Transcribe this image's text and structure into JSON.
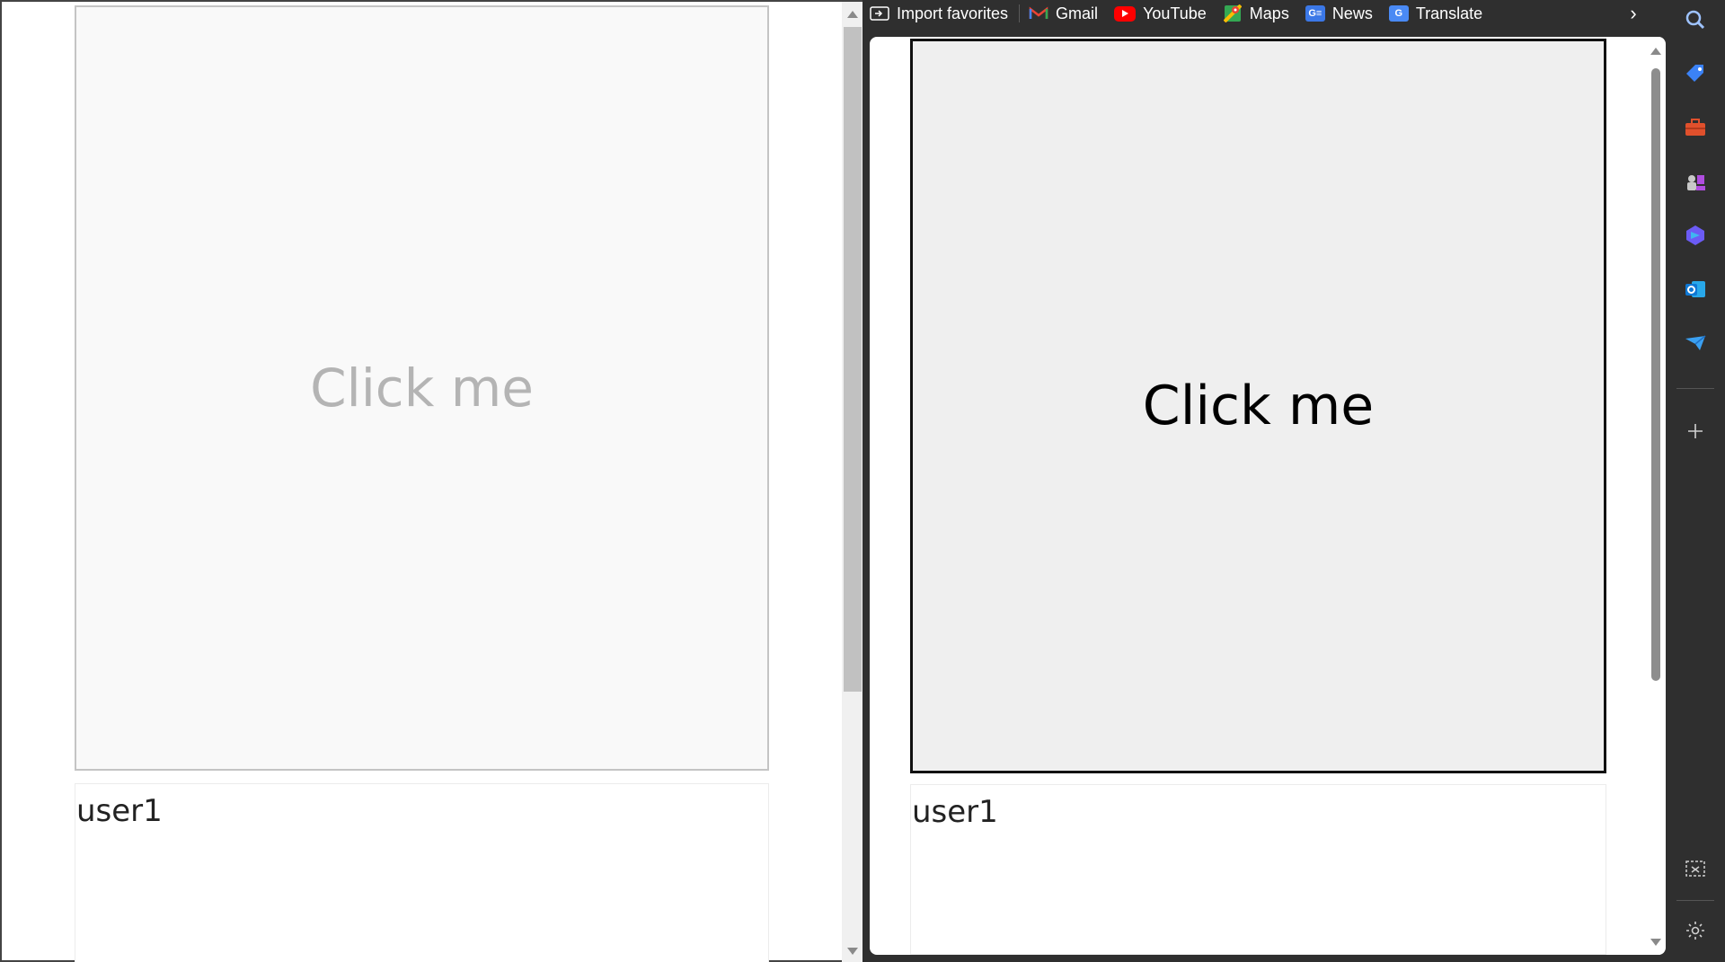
{
  "left_window": {
    "button_label": "Click me",
    "user_text": "user1"
  },
  "right_window": {
    "favorites": [
      {
        "label": "Import favorites",
        "icon": "import-favorites-icon"
      },
      {
        "label": "Gmail",
        "icon": "gmail-icon"
      },
      {
        "label": "YouTube",
        "icon": "youtube-icon"
      },
      {
        "label": "Maps",
        "icon": "maps-icon"
      },
      {
        "label": "News",
        "icon": "news-icon"
      },
      {
        "label": "Translate",
        "icon": "translate-icon"
      }
    ],
    "button_label": "Click me",
    "user_text": "user1",
    "sidebar_icons": [
      "search-icon",
      "tag-icon",
      "toolbox-icon",
      "games-icon",
      "copilot-icon",
      "outlook-icon",
      "send-icon",
      "add-icon",
      "screenshot-icon",
      "settings-icon"
    ]
  },
  "colors": {
    "browser_chrome": "#2f2f2f",
    "youtube_red": "#ff0000",
    "news_blue": "#3b78e7",
    "translate_blue": "#4a8af4",
    "outlook_blue": "#0f78d4"
  }
}
